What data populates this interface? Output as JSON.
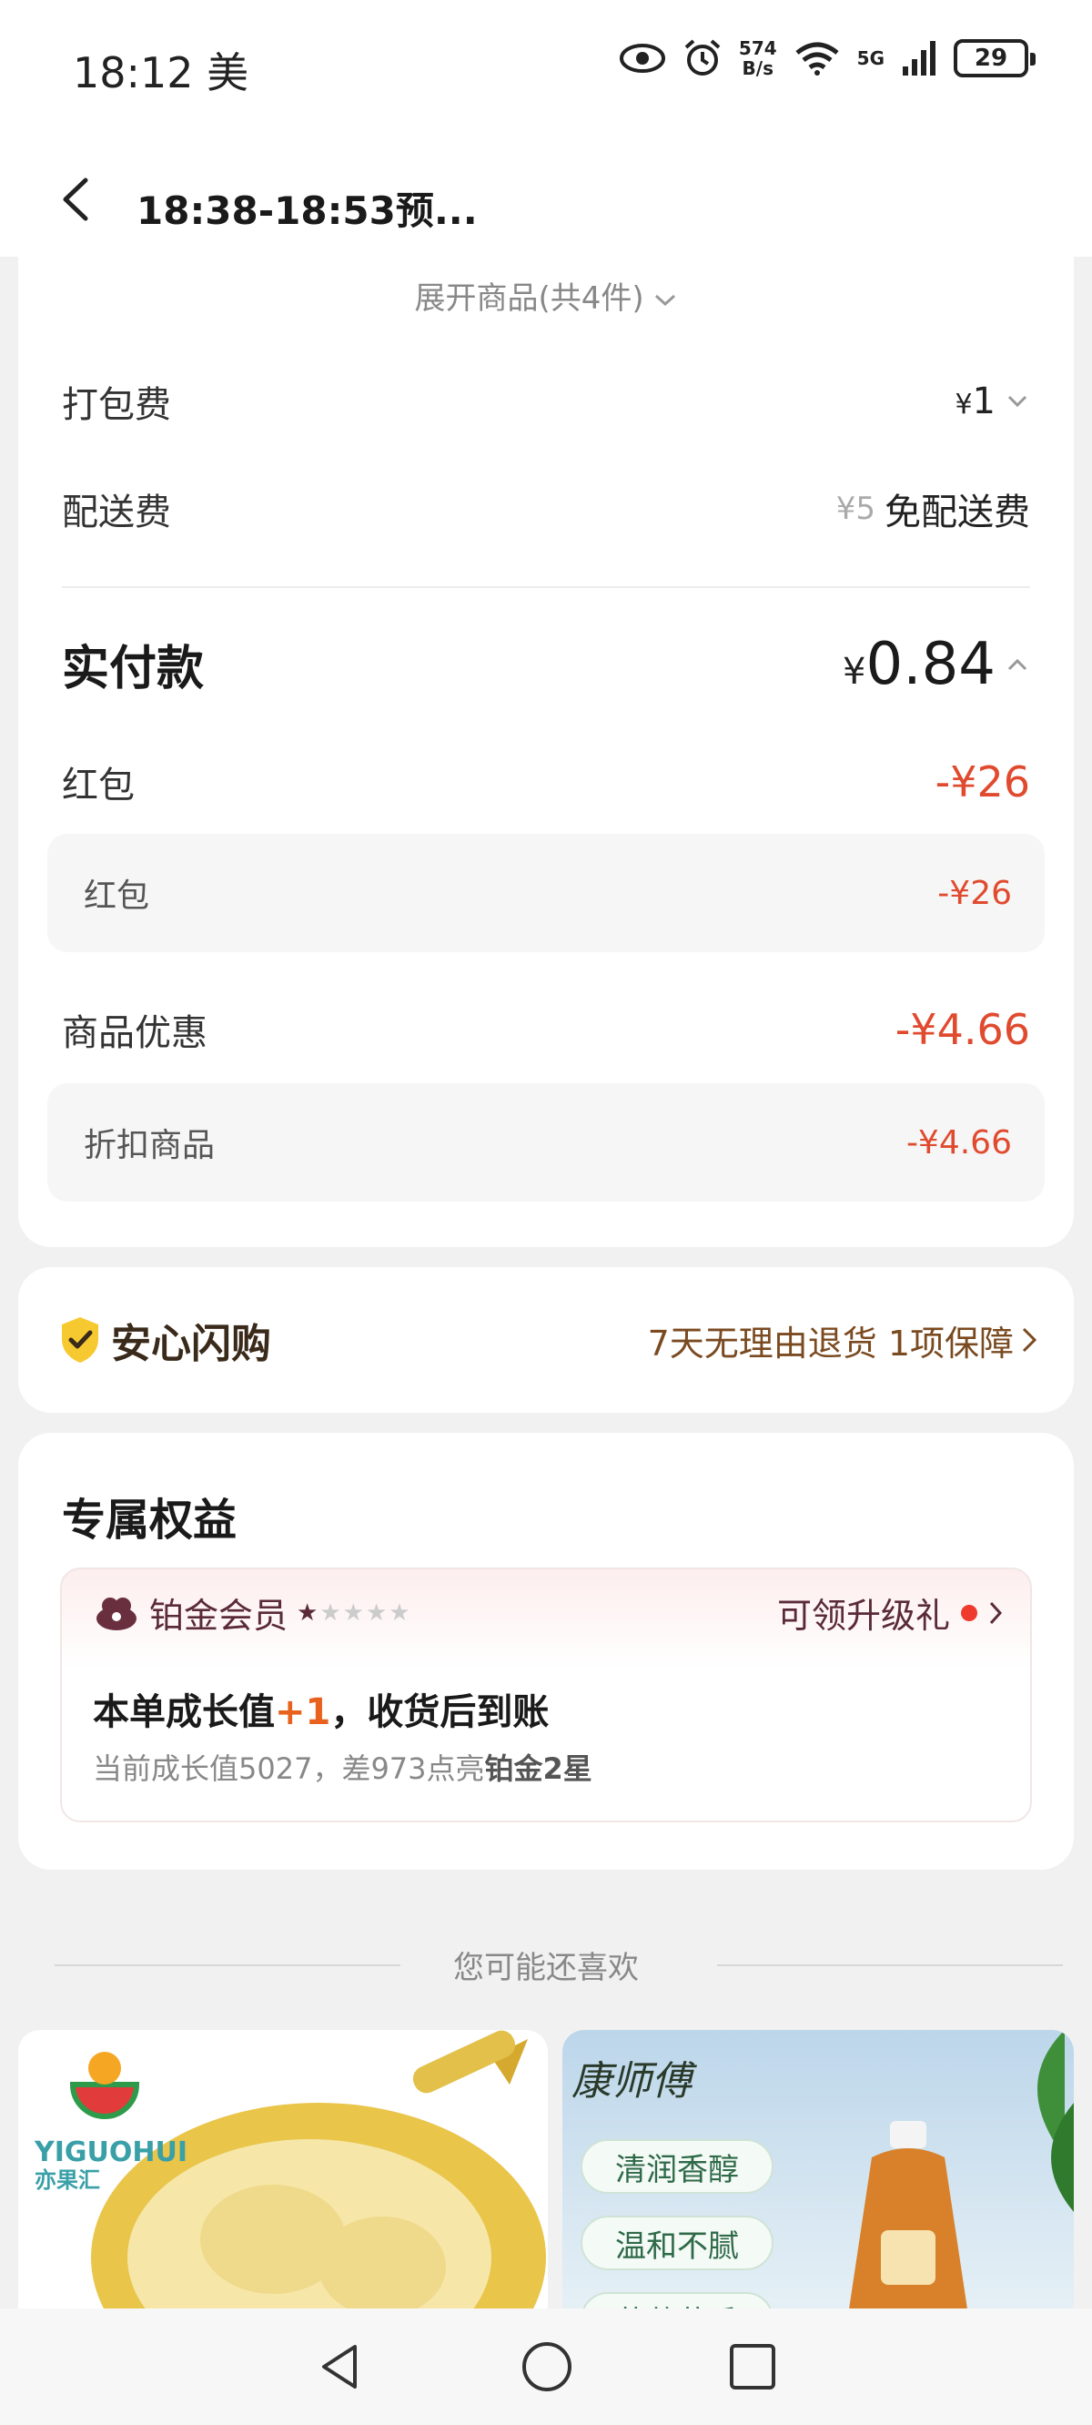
{
  "status_bar": {
    "time": "18:12 美",
    "net_speed_top": "574",
    "net_speed_bottom": "B/s",
    "network": "5G",
    "battery": "29"
  },
  "header": {
    "title": "18:38-18:53预..."
  },
  "order_summary": {
    "expand_label": "展开商品(共4件)",
    "packing_fee": {
      "label": "打包费",
      "value": "1"
    },
    "delivery_fee": {
      "label": "配送费",
      "original": "¥5",
      "value": "免配送费"
    },
    "total": {
      "label": "实付款",
      "value": "0.84"
    },
    "red_packet": {
      "label": "红包",
      "value": "-¥26",
      "detail_label": "红包",
      "detail_value": "-¥26"
    },
    "product_discount": {
      "label": "商品优惠",
      "value": "-¥4.66",
      "detail_label": "折扣商品",
      "detail_value": "-¥4.66"
    }
  },
  "guarantee": {
    "title": "安心闪购",
    "summary": "7天无理由退货 1项保障"
  },
  "benefits": {
    "title": "专属权益",
    "member_level": "铂金会员",
    "stars_filled": 1,
    "stars_total": 5,
    "gift_label": "可领升级礼",
    "growth_prefix": "本单成长值",
    "growth_plus": "+1",
    "growth_suffix": "，收货后到账",
    "growth_sub_prefix": "当前成长值5027，差973点亮",
    "growth_sub_bold": "铂金2星"
  },
  "recommendations": {
    "title": "您可能还喜欢",
    "item1_brand": "YIGUOHUI",
    "item1_brand_cn": "亦果汇",
    "item2_brand": "康师傅",
    "item2_tags": [
      "清润香醇",
      "温和不腻",
      "草莓花香"
    ]
  },
  "colors": {
    "accent_red": "#e04a2e",
    "growth_orange": "#e8621e",
    "member_plum": "#5a2a38",
    "guarantee_brown": "#7a4a20"
  }
}
